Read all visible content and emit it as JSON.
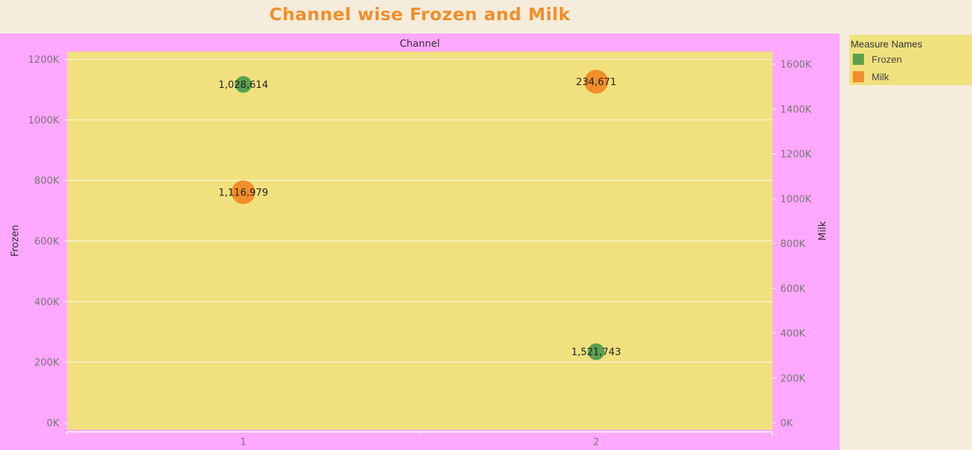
{
  "title": "Channel wise Frozen and Milk",
  "chart_data": {
    "type": "scatter",
    "column_header": "Channel",
    "categories": [
      "1",
      "2"
    ],
    "y_left": {
      "label": "Frozen",
      "ticks": [
        "0K",
        "200K",
        "400K",
        "600K",
        "800K",
        "1000K",
        "1200K"
      ],
      "range": [
        0,
        1200000
      ]
    },
    "y_right": {
      "label": "Milk",
      "ticks": [
        "0K",
        "200K",
        "400K",
        "600K",
        "800K",
        "1000K",
        "1200K",
        "1400K",
        "1600K"
      ],
      "range": [
        0,
        1600000
      ]
    },
    "series": [
      {
        "name": "Frozen",
        "axis": "left",
        "color": "#59a14f",
        "values": [
          1116979,
          234671
        ],
        "labels": [
          "1,028,614",
          "1,521,743"
        ]
      },
      {
        "name": "Milk",
        "axis": "right",
        "color": "#f28e2b",
        "values": [
          1028614,
          1521743
        ],
        "labels": [
          "1,116,979",
          "234,671"
        ]
      }
    ],
    "grid": true,
    "legend_position": "right"
  },
  "legend": {
    "title": "Measure Names",
    "items": [
      {
        "label": "Frozen",
        "color": "#59a14f"
      },
      {
        "label": "Milk",
        "color": "#f28e2b"
      }
    ]
  },
  "colors": {
    "panel": "#ffa8ff",
    "plot": "#f0e17e",
    "background": "#f5ecdb",
    "title": "#f28e2b"
  }
}
